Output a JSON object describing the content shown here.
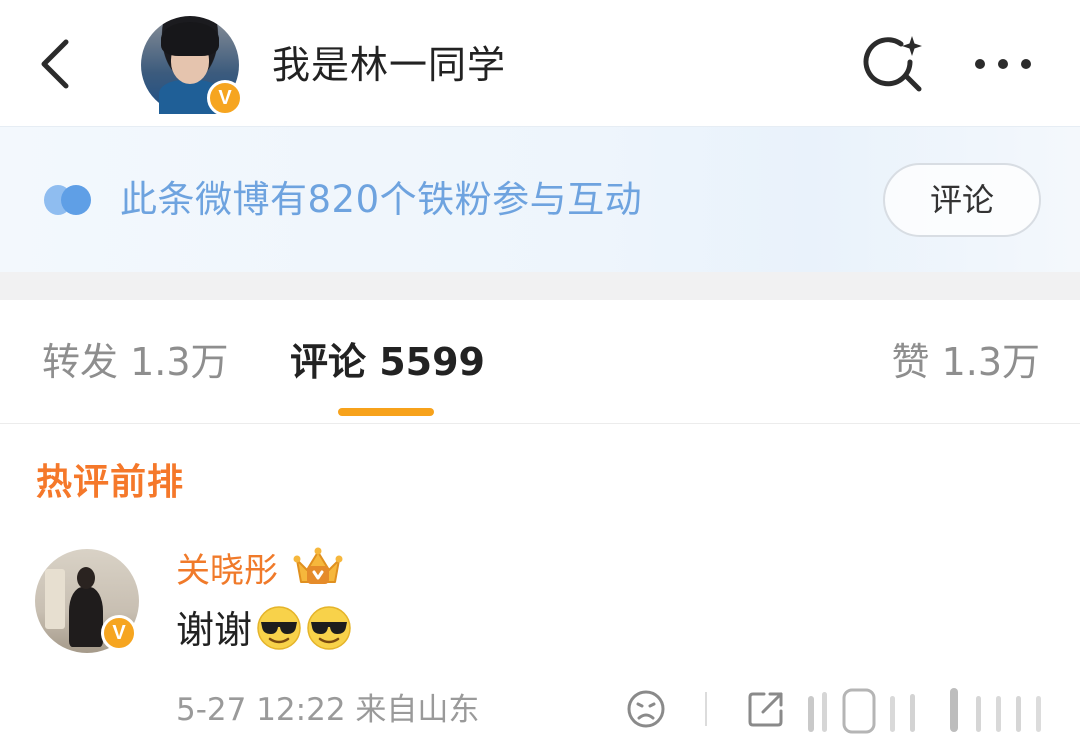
{
  "header": {
    "back_icon": "chevron-left-icon",
    "username": "我是林一同学",
    "verified_badge": "V",
    "search_icon": "search-sparkle-icon",
    "more_icon": "more-horizontal-icon"
  },
  "banner": {
    "icon": "fan-bubble-icon",
    "text": "此条微博有820个铁粉参与互动",
    "button_label": "评论",
    "accent": "#6ea3df"
  },
  "tabs": [
    {
      "label": "转发 1.3万",
      "active": false
    },
    {
      "label": "评论 5599",
      "active": true
    },
    {
      "label": "赞 1.3万",
      "active": false
    }
  ],
  "tab_accent": "#f7a21b",
  "hot_section": {
    "title": "热评前排",
    "color": "#f5782a"
  },
  "comments": [
    {
      "name": "关晓彤",
      "verified_badge": "V",
      "crown_icon": "crown-badge-icon",
      "text": "谢谢",
      "emojis": [
        "cool-sunglasses-emoji",
        "cool-sunglasses-emoji"
      ],
      "meta": "5-27 12:22  来自山东"
    }
  ]
}
